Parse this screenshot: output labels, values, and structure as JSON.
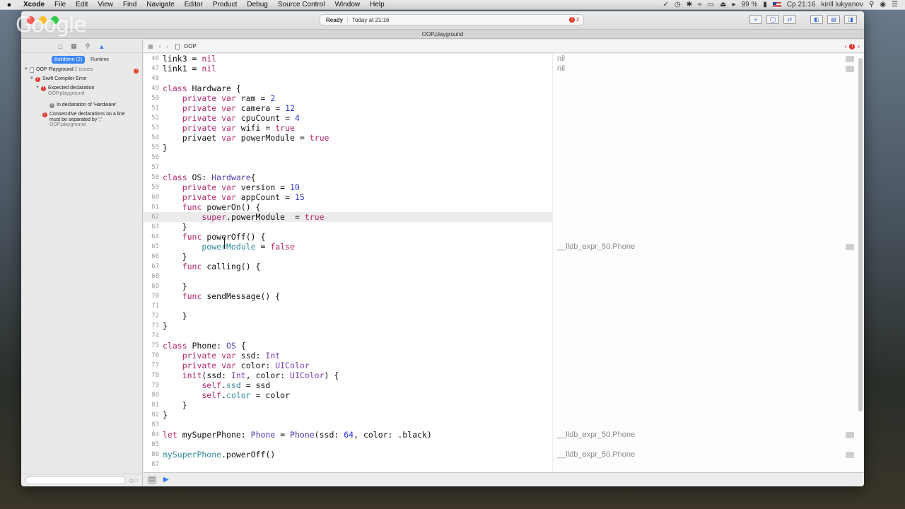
{
  "menubar": {
    "apple": "",
    "app_name": "Xcode",
    "items": [
      "File",
      "Edit",
      "View",
      "Find",
      "Navigate",
      "Editor",
      "Product",
      "Debug",
      "Source Control",
      "Window",
      "Help"
    ],
    "battery": "99 %",
    "clock": "Ср 21:16",
    "user": "kirill lukyanov"
  },
  "watermark": "Google",
  "toolbar": {
    "status_ready": "Ready",
    "status_time": "Today at 21:16",
    "error_count": "2"
  },
  "tab_title": "OOP.playground",
  "navigator": {
    "segments": [
      "Buildtime (2)",
      "Runtime"
    ],
    "issues": [
      {
        "label": "OOP Playground",
        "sub": "2 issues",
        "type": "file"
      },
      {
        "label": "Swift Compiler Error",
        "type": "error"
      },
      {
        "label": "Expected declaration",
        "sub": "OOP.playground",
        "type": "error"
      },
      {
        "label": "In declaration of 'Hardware'",
        "type": "note"
      },
      {
        "label": "Consecutive declarations on a line",
        "label2": "must be separated by ';'",
        "sub": "OOP.playground",
        "type": "error"
      }
    ]
  },
  "jumpbar": {
    "crumb": "OOP"
  },
  "code_lines": [
    {
      "n": "46",
      "segs": [
        [
          "link3 = ",
          ""
        ],
        [
          "nil",
          "k"
        ]
      ]
    },
    {
      "n": "47",
      "segs": [
        [
          "link1 = ",
          ""
        ],
        [
          "nil",
          "k"
        ]
      ]
    },
    {
      "n": "48",
      "segs": []
    },
    {
      "n": "49",
      "segs": [
        [
          "class",
          "k"
        ],
        [
          " Hardware {",
          ""
        ]
      ]
    },
    {
      "n": "50",
      "segs": [
        [
          "    private var",
          "k"
        ],
        [
          " ram = ",
          ""
        ],
        [
          "2",
          "n"
        ]
      ]
    },
    {
      "n": "51",
      "segs": [
        [
          "    private var",
          "k"
        ],
        [
          " camera = ",
          ""
        ],
        [
          "12",
          "n"
        ]
      ]
    },
    {
      "n": "52",
      "segs": [
        [
          "    private var",
          "k"
        ],
        [
          " cpuCount = ",
          ""
        ],
        [
          "4",
          "n"
        ]
      ]
    },
    {
      "n": "53",
      "segs": [
        [
          "    private var",
          "k"
        ],
        [
          " wifi = ",
          ""
        ],
        [
          "true",
          "k"
        ]
      ]
    },
    {
      "n": "54",
      "segs": [
        [
          "    privaet ",
          ""
        ],
        [
          "var",
          "k"
        ],
        [
          " powerModule = ",
          ""
        ],
        [
          "true",
          "k"
        ]
      ]
    },
    {
      "n": "55",
      "segs": [
        [
          "}",
          ""
        ]
      ]
    },
    {
      "n": "56",
      "segs": []
    },
    {
      "n": "57",
      "segs": []
    },
    {
      "n": "58",
      "segs": [
        [
          "class",
          "k"
        ],
        [
          " OS: ",
          ""
        ],
        [
          "Hardware",
          "t"
        ],
        [
          "{",
          ""
        ]
      ]
    },
    {
      "n": "59",
      "segs": [
        [
          "    private var",
          "k"
        ],
        [
          " version = ",
          ""
        ],
        [
          "10",
          "n"
        ]
      ]
    },
    {
      "n": "60",
      "segs": [
        [
          "    private var",
          "k"
        ],
        [
          " appCount = ",
          ""
        ],
        [
          "15",
          "n"
        ]
      ]
    },
    {
      "n": "61",
      "segs": [
        [
          "    func",
          "k"
        ],
        [
          " powerOn() {",
          ""
        ]
      ]
    },
    {
      "n": "62",
      "segs": [
        [
          "        super",
          "k"
        ],
        [
          ".powerModule  = ",
          ""
        ],
        [
          "true",
          "k"
        ]
      ],
      "current": true
    },
    {
      "n": "63",
      "segs": [
        [
          "    }",
          ""
        ]
      ]
    },
    {
      "n": "64",
      "segs": [
        [
          "    func",
          "k"
        ],
        [
          " powerOff() {",
          ""
        ]
      ]
    },
    {
      "n": "65",
      "segs": [
        [
          "        powerModule",
          "f"
        ],
        [
          " = ",
          ""
        ],
        [
          "false",
          "k"
        ]
      ]
    },
    {
      "n": "66",
      "segs": [
        [
          "    }",
          ""
        ]
      ]
    },
    {
      "n": "67",
      "segs": [
        [
          "    func",
          "k"
        ],
        [
          " calling() {",
          ""
        ]
      ]
    },
    {
      "n": "68",
      "segs": []
    },
    {
      "n": "69",
      "segs": [
        [
          "    }",
          ""
        ]
      ]
    },
    {
      "n": "70",
      "segs": [
        [
          "    func",
          "k"
        ],
        [
          " sendMessage() {",
          ""
        ]
      ]
    },
    {
      "n": "71",
      "segs": []
    },
    {
      "n": "72",
      "segs": [
        [
          "    }",
          ""
        ]
      ]
    },
    {
      "n": "73",
      "segs": [
        [
          "}",
          ""
        ]
      ]
    },
    {
      "n": "74",
      "segs": []
    },
    {
      "n": "75",
      "segs": [
        [
          "class",
          "k"
        ],
        [
          " Phone: ",
          ""
        ],
        [
          "OS",
          "t"
        ],
        [
          " {",
          ""
        ]
      ]
    },
    {
      "n": "76",
      "segs": [
        [
          "    private var",
          "k"
        ],
        [
          " ssd: ",
          ""
        ],
        [
          "Int",
          "p"
        ]
      ]
    },
    {
      "n": "77",
      "segs": [
        [
          "    private var",
          "k"
        ],
        [
          " color: ",
          ""
        ],
        [
          "UIColor",
          "p"
        ]
      ]
    },
    {
      "n": "78",
      "segs": [
        [
          "    init",
          "k"
        ],
        [
          "(ssd: ",
          ""
        ],
        [
          "Int",
          "p"
        ],
        [
          ", color: ",
          ""
        ],
        [
          "UIColor",
          "p"
        ],
        [
          ") {",
          ""
        ]
      ]
    },
    {
      "n": "79",
      "segs": [
        [
          "        self",
          "k"
        ],
        [
          ".",
          ""
        ],
        [
          "ssd",
          "f"
        ],
        [
          " = ssd",
          ""
        ]
      ]
    },
    {
      "n": "80",
      "segs": [
        [
          "        self",
          "k"
        ],
        [
          ".",
          ""
        ],
        [
          "color",
          "f"
        ],
        [
          " = color",
          ""
        ]
      ]
    },
    {
      "n": "81",
      "segs": [
        [
          "    }",
          ""
        ]
      ]
    },
    {
      "n": "82",
      "segs": [
        [
          "}",
          ""
        ]
      ]
    },
    {
      "n": "83",
      "segs": []
    },
    {
      "n": "84",
      "segs": [
        [
          "let",
          "k"
        ],
        [
          " mySuperPhone: ",
          ""
        ],
        [
          "Phone",
          "t"
        ],
        [
          " = ",
          ""
        ],
        [
          "Phone",
          "t"
        ],
        [
          "(ssd: ",
          ""
        ],
        [
          "64",
          "n"
        ],
        [
          ", color: .black)",
          ""
        ]
      ]
    },
    {
      "n": "85",
      "segs": []
    },
    {
      "n": "86",
      "segs": [
        [
          "mySuperPhone",
          "f"
        ],
        [
          ".powerOff()",
          ""
        ]
      ]
    },
    {
      "n": "87",
      "segs": []
    }
  ],
  "results": [
    {
      "line": 0,
      "text": "nil"
    },
    {
      "line": 1,
      "text": "nil"
    },
    {
      "line": 19,
      "text": "__lldb_expr_50.Phone"
    },
    {
      "line": 38,
      "text": "__lldb_expr_50.Phone"
    },
    {
      "line": 40,
      "text": "__lldb_expr_50.Phone"
    }
  ]
}
